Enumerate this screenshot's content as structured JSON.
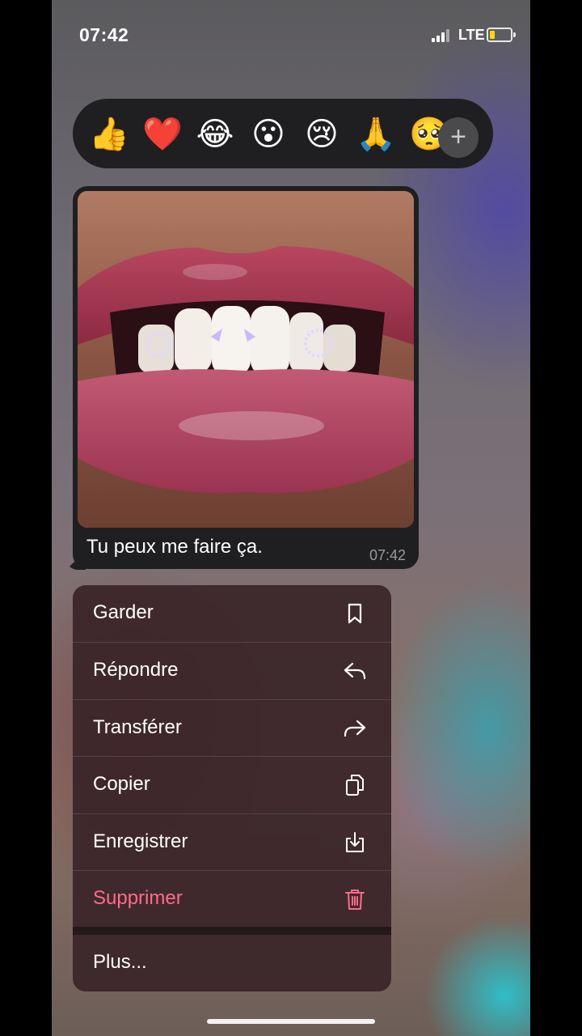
{
  "status_bar": {
    "time": "07:42",
    "network": "LTE",
    "battery_color": "#ffd60a"
  },
  "reactions": [
    {
      "emoji": "👍",
      "name": "thumbs-up-reaction"
    },
    {
      "emoji": "❤️",
      "name": "heart-reaction"
    },
    {
      "emoji": "😂",
      "name": "laughing-reaction"
    },
    {
      "emoji": "😮",
      "name": "surprised-reaction"
    },
    {
      "emoji": "😢",
      "name": "crying-reaction"
    },
    {
      "emoji": "🙏",
      "name": "pray-reaction"
    },
    {
      "emoji": "🥺",
      "name": "pleading-reaction"
    }
  ],
  "message": {
    "caption": "Tu peux me faire ça.",
    "time": "07:42"
  },
  "menu": {
    "items": [
      {
        "label": "Garder",
        "icon": "bookmark-icon"
      },
      {
        "label": "Répondre",
        "icon": "reply-icon"
      },
      {
        "label": "Transférer",
        "icon": "forward-icon"
      },
      {
        "label": "Copier",
        "icon": "copy-icon"
      },
      {
        "label": "Enregistrer",
        "icon": "save-download-icon"
      },
      {
        "label": "Supprimer",
        "icon": "trash-icon"
      }
    ],
    "more_label": "Plus...",
    "danger_color": "#ff6b8a"
  }
}
